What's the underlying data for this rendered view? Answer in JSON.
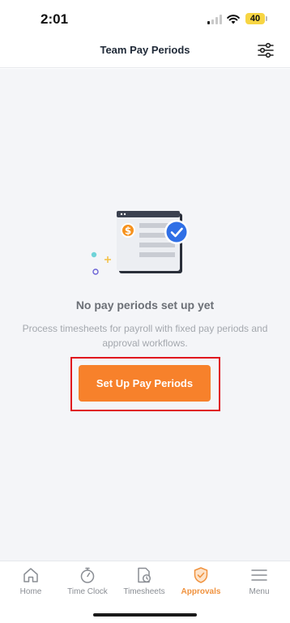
{
  "status_bar": {
    "time": "2:01",
    "battery": "40"
  },
  "header": {
    "title": "Team Pay Periods",
    "filter_icon": "sliders-icon"
  },
  "empty_state": {
    "title": "No pay periods set up yet",
    "description": "Process timesheets for payroll with fixed pay periods and approval workflows.",
    "cta_label": "Set Up Pay Periods",
    "illustration_icon": "payroll-document-check-icon",
    "currency_symbol": "$"
  },
  "tab_bar": {
    "tabs": [
      {
        "label": "Home",
        "icon": "home-icon",
        "active": false
      },
      {
        "label": "Time Clock",
        "icon": "stopwatch-icon",
        "active": false
      },
      {
        "label": "Timesheets",
        "icon": "timesheet-icon",
        "active": false
      },
      {
        "label": "Approvals",
        "icon": "shield-check-icon",
        "active": true
      },
      {
        "label": "Menu",
        "icon": "menu-icon",
        "active": false
      }
    ]
  },
  "colors": {
    "accent": "#f7812b",
    "active_tab": "#f0923e",
    "highlight_outline": "#e0131d",
    "check_badge": "#2f6fe6",
    "content_bg": "#f4f5f8"
  }
}
